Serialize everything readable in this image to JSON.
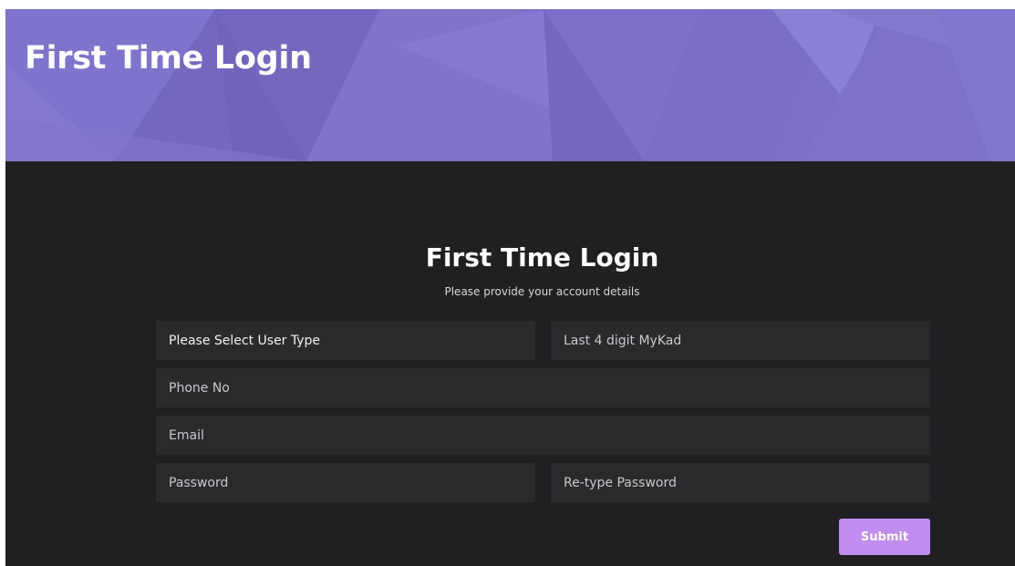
{
  "header": {
    "title": "First Time Login",
    "background_color": "#7a6fc4"
  },
  "form": {
    "heading": "First Time Login",
    "subheading": "Please provide your account details",
    "user_type": {
      "selected": "Please Select User Type"
    },
    "mykad": {
      "placeholder": "Last 4 digit MyKad"
    },
    "phone": {
      "placeholder": "Phone No"
    },
    "email": {
      "placeholder": "Email"
    },
    "password": {
      "placeholder": "Password"
    },
    "retype_password": {
      "placeholder": "Re-type Password"
    },
    "submit_label": "Submit",
    "accent_color": "#c18df0",
    "field_color": "#2a2a2d",
    "page_background": "#202022"
  }
}
